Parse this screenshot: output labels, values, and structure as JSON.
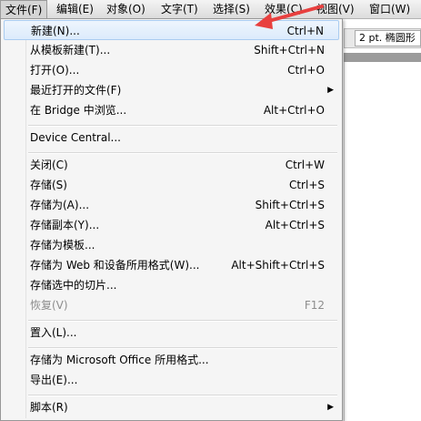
{
  "menubar": {
    "items": [
      {
        "label": "文件(F)"
      },
      {
        "label": "编辑(E)"
      },
      {
        "label": "对象(O)"
      },
      {
        "label": "文字(T)"
      },
      {
        "label": "选择(S)"
      },
      {
        "label": "效果(C)"
      },
      {
        "label": "视图(V)"
      },
      {
        "label": "窗口(W)"
      }
    ]
  },
  "toolbar": {
    "stroke_text": "2 pt. 椭圆形"
  },
  "file_menu": {
    "items": [
      {
        "label": "新建(N)...",
        "shortcut": "Ctrl+N"
      },
      {
        "label": "从模板新建(T)...",
        "shortcut": "Shift+Ctrl+N"
      },
      {
        "label": "打开(O)...",
        "shortcut": "Ctrl+O"
      },
      {
        "label": "最近打开的文件(F)",
        "shortcut": ""
      },
      {
        "label": "在 Bridge 中浏览...",
        "shortcut": "Alt+Ctrl+O"
      },
      {
        "label": "Device Central...",
        "shortcut": ""
      },
      {
        "label": "关闭(C)",
        "shortcut": "Ctrl+W"
      },
      {
        "label": "存储(S)",
        "shortcut": "Ctrl+S"
      },
      {
        "label": "存储为(A)...",
        "shortcut": "Shift+Ctrl+S"
      },
      {
        "label": "存储副本(Y)...",
        "shortcut": "Alt+Ctrl+S"
      },
      {
        "label": "存储为模板...",
        "shortcut": ""
      },
      {
        "label": "存储为 Web 和设备所用格式(W)...",
        "shortcut": "Alt+Shift+Ctrl+S"
      },
      {
        "label": "存储选中的切片...",
        "shortcut": ""
      },
      {
        "label": "恢复(V)",
        "shortcut": "F12"
      },
      {
        "label": "置入(L)...",
        "shortcut": ""
      },
      {
        "label": "存储为 Microsoft Office 所用格式...",
        "shortcut": ""
      },
      {
        "label": "导出(E)...",
        "shortcut": ""
      },
      {
        "label": "脚本(R)",
        "shortcut": ""
      }
    ],
    "highlight_color": "#dcebfc",
    "disabled_color": "#8d8d8d"
  },
  "annotation": {
    "arrow_color": "#e8403f"
  }
}
